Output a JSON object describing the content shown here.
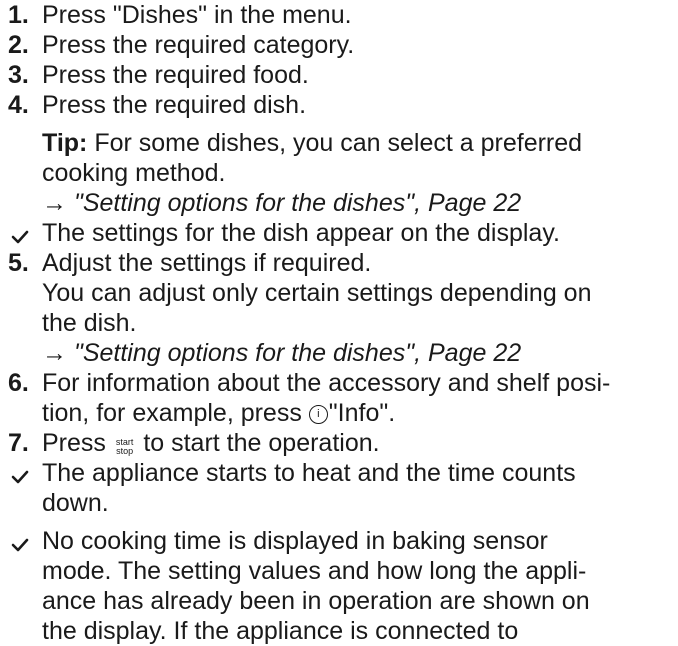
{
  "steps": [
    {
      "num": "1.",
      "text": "Press \"Dishes\" in the menu."
    },
    {
      "num": "2.",
      "text": "Press the required category."
    },
    {
      "num": "3.",
      "text": "Press the required food."
    },
    {
      "num": "4.",
      "text": "Press the required dish."
    }
  ],
  "tip": {
    "label": "Tip:",
    "line1": " For some dishes, you can select a preferred",
    "line2": "cooking method.",
    "ref_arrow": "→",
    "ref_text": " \"Setting options for the dishes\", Page 22"
  },
  "result1": "The settings for the dish appear on the display.",
  "step5": {
    "num": "5.",
    "line1": "Adjust the settings if required.",
    "line2": "You can adjust only certain settings depending on",
    "line3": "the dish.",
    "ref_arrow": "→",
    "ref_text": " \"Setting options for the dishes\", Page 22"
  },
  "step6": {
    "num": "6.",
    "line1": "For information about the accessory and shelf posi-",
    "line2a": "tion, for example, press ",
    "icon_glyph": "i",
    "line2b": "\"Info\"."
  },
  "step7": {
    "num": "7.",
    "text_a": "Press ",
    "icon_top": "start",
    "icon_bottom": "stop",
    "text_b": " to start the operation."
  },
  "result2": {
    "line1": "The appliance starts to heat and the time counts",
    "line2": "down."
  },
  "result3": {
    "line1": "No cooking time is displayed in baking sensor",
    "line2": "mode. The setting values and how long the appli-",
    "line3": "ance has already been in operation are shown on",
    "line4": "the display. If the appliance is connected to"
  },
  "icons": {
    "check": "checkmark-icon",
    "info": "info-icon",
    "startstop": "start-stop-icon"
  }
}
